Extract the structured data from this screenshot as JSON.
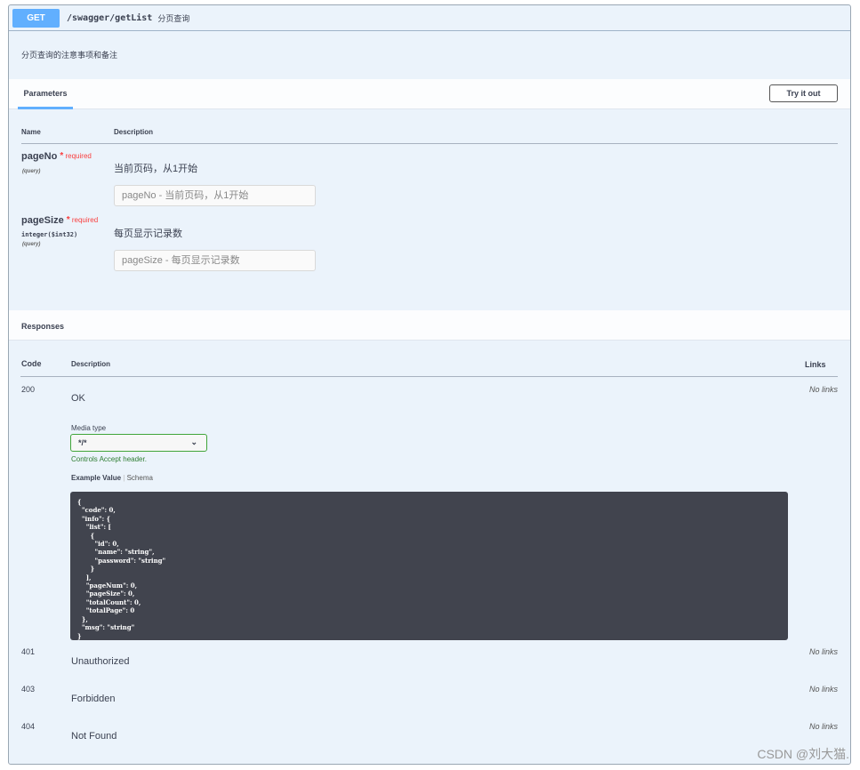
{
  "operation": {
    "method": "GET",
    "path": "/swagger/getList",
    "summary": "分页查询",
    "description": "分页查询的注意事项和备注"
  },
  "parameters": {
    "tab": "Parameters",
    "try_it_out": "Try it out",
    "col_name": "Name",
    "col_description": "Description",
    "items": [
      {
        "name": "pageNo",
        "required_star": "*",
        "required": "required",
        "type": "",
        "in": "(query)",
        "description": "当前页码，从1开始",
        "placeholder": "pageNo - 当前页码，从1开始"
      },
      {
        "name": "pageSize",
        "required_star": "*",
        "required": "required",
        "type": "integer($int32)",
        "in": "(query)",
        "description": "每页显示记录数",
        "placeholder": "pageSize - 每页显示记录数"
      }
    ]
  },
  "responses": {
    "title": "Responses",
    "col_code": "Code",
    "col_description": "Description",
    "col_links": "Links",
    "media_type_label": "Media type",
    "media_type": "*/*",
    "controls_note": "Controls Accept header.",
    "example_tab": "Example Value",
    "schema_tab": "Schema",
    "example": "{\n  \"code\": 0,\n  \"info\": {\n    \"list\": [\n      {\n        \"id\": 0,\n        \"name\": \"string\",\n        \"password\": \"string\"\n      }\n    ],\n    \"pageNum\": 0,\n    \"pageSize\": 0,\n    \"totalCount\": 0,\n    \"totalPage\": 0\n  },\n  \"msg\": \"string\"\n}",
    "items": [
      {
        "code": "200",
        "description": "OK",
        "links": "No links"
      },
      {
        "code": "401",
        "description": "Unauthorized",
        "links": "No links"
      },
      {
        "code": "403",
        "description": "Forbidden",
        "links": "No links"
      },
      {
        "code": "404",
        "description": "Not Found",
        "links": "No links"
      }
    ]
  },
  "watermark": "CSDN @刘大猫."
}
